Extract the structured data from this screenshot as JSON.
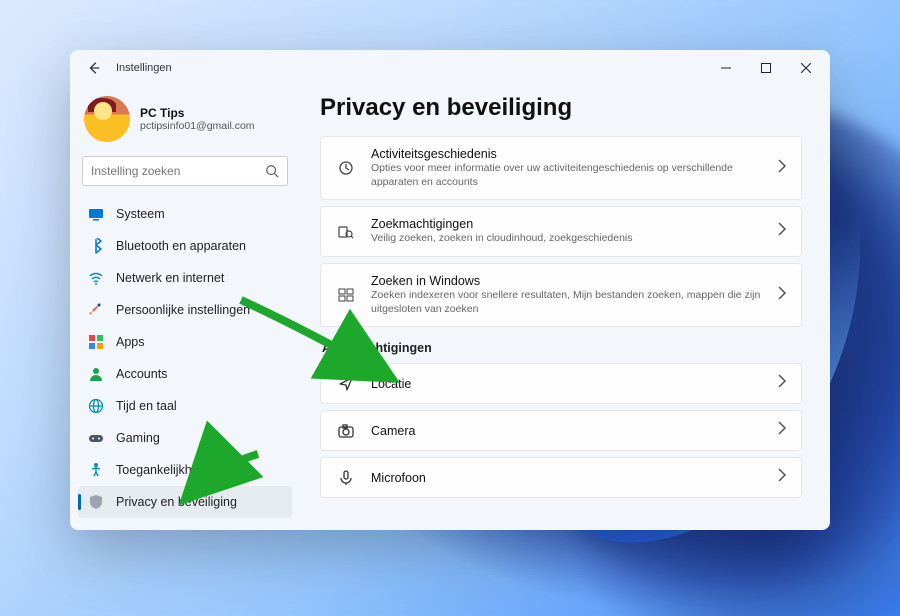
{
  "window": {
    "title": "Instellingen"
  },
  "profile": {
    "name": "PC Tips",
    "email": "pctipsinfo01@gmail.com"
  },
  "search": {
    "placeholder": "Instelling zoeken"
  },
  "nav": [
    {
      "id": "system",
      "label": "Systeem",
      "icon": "display"
    },
    {
      "id": "bluetooth",
      "label": "Bluetooth en apparaten",
      "icon": "bluetooth"
    },
    {
      "id": "network",
      "label": "Netwerk en internet",
      "icon": "wifi"
    },
    {
      "id": "personal",
      "label": "Persoonlijke instellingen",
      "icon": "brush"
    },
    {
      "id": "apps",
      "label": "Apps",
      "icon": "apps"
    },
    {
      "id": "accounts",
      "label": "Accounts",
      "icon": "person"
    },
    {
      "id": "time",
      "label": "Tijd en taal",
      "icon": "globe"
    },
    {
      "id": "gaming",
      "label": "Gaming",
      "icon": "gamepad"
    },
    {
      "id": "access",
      "label": "Toegankelijkheid",
      "icon": "access"
    },
    {
      "id": "privacy",
      "label": "Privacy en beveiliging",
      "icon": "shield",
      "active": true
    }
  ],
  "page": {
    "title": "Privacy en beveiliging",
    "cards_top": [
      {
        "id": "activity",
        "title": "Activiteitsgeschiedenis",
        "sub": "Opties voor meer informatie over uw activiteitengeschiedenis op verschillende apparaten en accounts",
        "icon": "history"
      },
      {
        "id": "searchperm",
        "title": "Zoekmachtigingen",
        "sub": "Veilig zoeken, zoeken in cloudinhoud, zoekgeschiedenis",
        "icon": "searchperm"
      },
      {
        "id": "searchwin",
        "title": "Zoeken in Windows",
        "sub": "Zoeken indexeren voor snellere resultaten, Mijn bestanden zoeken, mappen die zijn uitgesloten van zoeken",
        "icon": "searchwin"
      }
    ],
    "section_app": "App-machtigingen",
    "cards_app": [
      {
        "id": "location",
        "title": "Locatie",
        "icon": "location"
      },
      {
        "id": "camera",
        "title": "Camera",
        "icon": "camera"
      },
      {
        "id": "mic",
        "title": "Microfoon",
        "icon": "mic"
      }
    ]
  }
}
